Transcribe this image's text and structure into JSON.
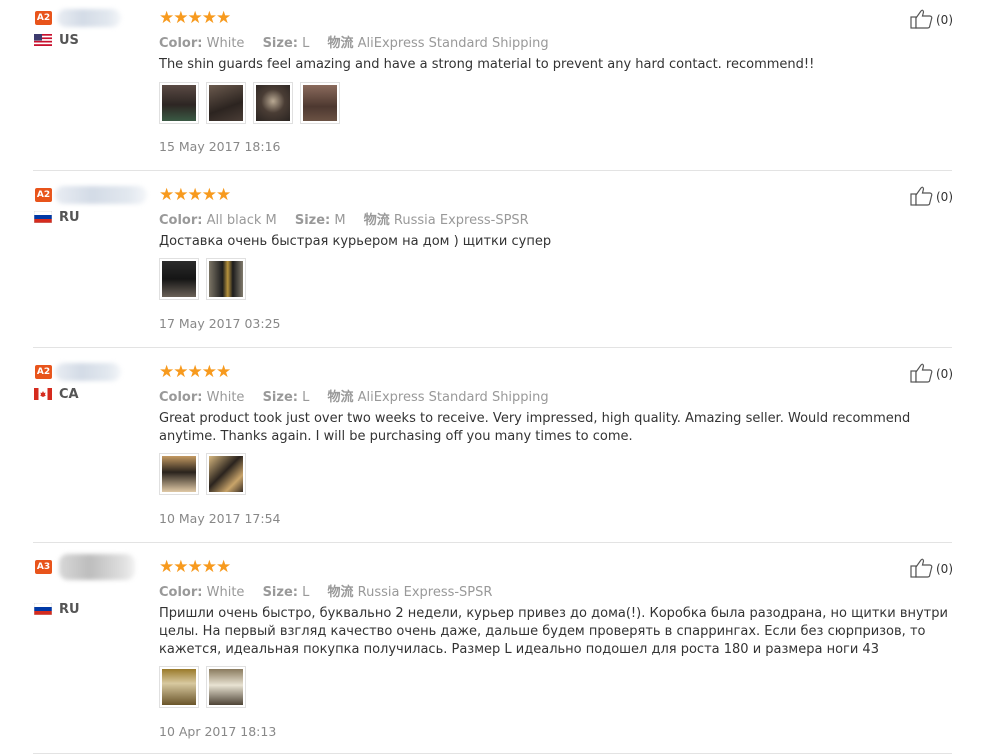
{
  "reviews": [
    {
      "level": "A2",
      "country": "US",
      "flag": "us",
      "stars": "★★★★★",
      "color_label": "Color:",
      "color_value": "White",
      "size_label": "Size:",
      "size_value": "L",
      "shipping_label": "物流",
      "shipping_value": "AliExpress Standard Shipping",
      "text": "The shin guards feel amazing and have a strong material to prevent any hard contact. recommend!!",
      "photos": [
        "photo-1",
        "photo-2",
        "photo-3",
        "photo-4"
      ],
      "date": "15 May 2017 18:16",
      "likes": "(0)"
    },
    {
      "level": "A2",
      "country": "RU",
      "flag": "ru",
      "stars": "★★★★★",
      "color_label": "Color:",
      "color_value": "All black M",
      "size_label": "Size:",
      "size_value": "M",
      "shipping_label": "物流",
      "shipping_value": "Russia Express-SPSR",
      "text": "Доставка очень быстрая курьером на дом ) щитки супер",
      "photos": [
        "photo-1",
        "photo-2"
      ],
      "date": "17 May 2017 03:25",
      "likes": "(0)"
    },
    {
      "level": "A2",
      "country": "CA",
      "flag": "ca",
      "stars": "★★★★★",
      "color_label": "Color:",
      "color_value": "White",
      "size_label": "Size:",
      "size_value": "L",
      "shipping_label": "物流",
      "shipping_value": "AliExpress Standard Shipping",
      "text": "Great product took just over two weeks to receive. Very impressed, high quality. Amazing seller. Would recommend anytime. Thanks again. I will be purchasing off you many times to come.",
      "photos": [
        "photo-1",
        "photo-2"
      ],
      "date": "10 May 2017 17:54",
      "likes": "(0)"
    },
    {
      "level": "A3",
      "country": "RU",
      "flag": "ru",
      "stars": "★★★★★",
      "color_label": "Color:",
      "color_value": "White",
      "size_label": "Size:",
      "size_value": "L",
      "shipping_label": "物流",
      "shipping_value": "Russia Express-SPSR",
      "text": "Пришли очень быстро, буквально 2 недели, курьер привез до дома(!). Коробка была разодрана, но щитки внутри целы. На первый взгляд качество очень даже, дальше будем проверять в спаррингах. Если без сюрпризов, то кажется, идеальная покупка получилась. Размер L идеально подошел для роста 180 и размера ноги 43",
      "photos": [
        "photo-1",
        "photo-2"
      ],
      "date": "10 Apr 2017 18:13",
      "likes": "(0)"
    }
  ],
  "colors": {
    "accent": "#e8541b",
    "stars": "#f79a1e",
    "meta": "#999999"
  }
}
